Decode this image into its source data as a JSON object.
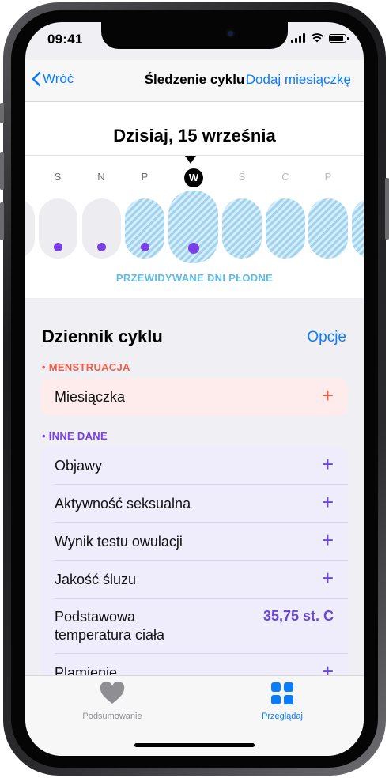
{
  "status_bar": {
    "time": "09:41"
  },
  "nav": {
    "back_label": "Wróć",
    "title": "Śledzenie cyklu",
    "action_label": "Dodaj miesiączkę"
  },
  "calendar": {
    "date_heading": "Dzisiaj, 15 września",
    "days": [
      {
        "letter": "",
        "state": "past",
        "has_dot": false
      },
      {
        "letter": "S",
        "state": "past",
        "has_dot": true
      },
      {
        "letter": "N",
        "state": "past",
        "has_dot": true
      },
      {
        "letter": "P",
        "state": "fertile",
        "has_dot": true
      },
      {
        "letter": "W",
        "state": "today",
        "has_dot": true
      },
      {
        "letter": "Ś",
        "state": "fertile",
        "has_dot": false
      },
      {
        "letter": "C",
        "state": "fertile",
        "has_dot": false
      },
      {
        "letter": "P",
        "state": "fertile",
        "has_dot": false
      },
      {
        "letter": "",
        "state": "fertile",
        "has_dot": false
      }
    ],
    "fertile_label": "PRZEWIDYWANE DNI PŁODNE"
  },
  "log": {
    "title": "Dziennik cyklu",
    "options_label": "Opcje",
    "menstruation": {
      "header": "• MENSTRUACJA",
      "items": [
        {
          "label": "Miesiączka",
          "action": "+"
        }
      ]
    },
    "other": {
      "header": "• INNE DANE",
      "items": [
        {
          "label": "Objawy",
          "action": "+"
        },
        {
          "label": "Aktywność seksualna",
          "action": "+"
        },
        {
          "label": "Wynik testu owulacji",
          "action": "+"
        },
        {
          "label": "Jakość śluzu",
          "action": "+"
        },
        {
          "label": "Podstawowa temperatura ciała",
          "value": "35,75 st. C"
        },
        {
          "label": "Plamienie",
          "action": "+"
        }
      ]
    }
  },
  "tabbar": {
    "tabs": [
      {
        "label": "Podsumowanie",
        "icon": "heart-icon",
        "active": false
      },
      {
        "label": "Przeglądaj",
        "icon": "grid-icon",
        "active": true
      }
    ]
  },
  "colors": {
    "accent": "#0a7cff",
    "menstruation": "#f25c4a",
    "other_data": "#7a3fe6",
    "fertile": "#5ebde8"
  }
}
